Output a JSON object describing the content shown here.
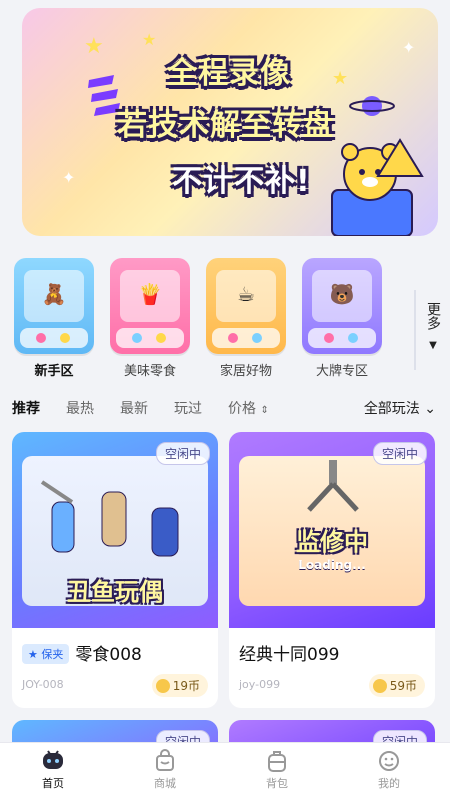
{
  "banner": {
    "line1": "全程录像",
    "line2": "若技术解至转盘",
    "line3": "不计不补!"
  },
  "categories": [
    {
      "label": "新手区",
      "active": true
    },
    {
      "label": "美味零食",
      "active": false
    },
    {
      "label": "家居好物",
      "active": false
    },
    {
      "label": "大牌专区",
      "active": false
    }
  ],
  "more": {
    "label": "更多"
  },
  "filters": {
    "items": [
      "推荐",
      "最热",
      "最新",
      "玩过",
      "价格"
    ],
    "all_label": "全部玩法"
  },
  "cards": [
    {
      "status": "空闲中",
      "banner_text": "丑鱼玩偶",
      "tag": "保夹",
      "title": "零食008",
      "code": "JOY-008",
      "price": "19币"
    },
    {
      "status": "空闲中",
      "banner_text": "监修中",
      "subtext": "Loading...",
      "title": "经典十同099",
      "code": "joy-099",
      "price": "59币"
    },
    {
      "status": "空闲中"
    },
    {
      "status": "空闲中"
    }
  ],
  "nav": {
    "items": [
      {
        "label": "首页",
        "icon": "home-icon",
        "active": true
      },
      {
        "label": "商城",
        "icon": "shop-icon",
        "active": false
      },
      {
        "label": "背包",
        "icon": "backpack-icon",
        "active": false
      },
      {
        "label": "我的",
        "icon": "profile-icon",
        "active": false
      }
    ]
  }
}
